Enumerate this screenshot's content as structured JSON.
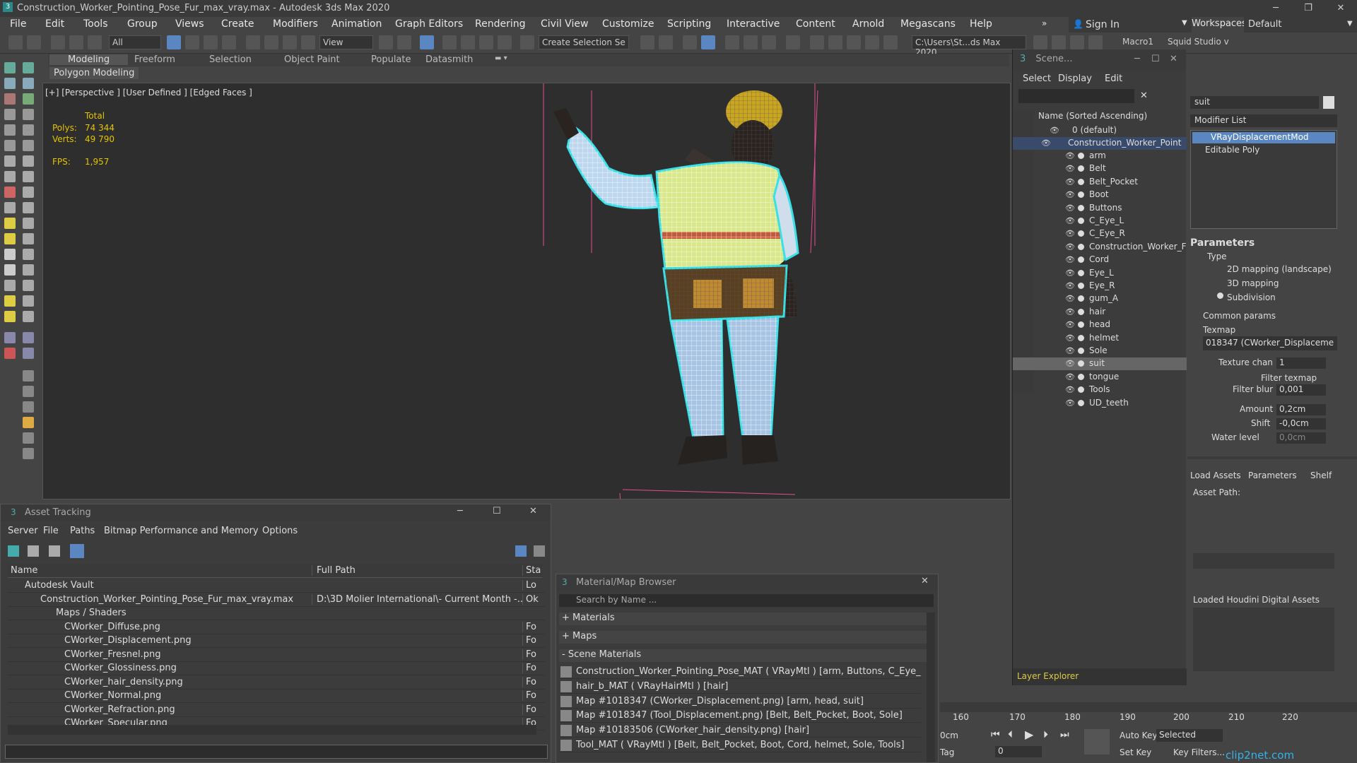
{
  "window": {
    "title": "Construction_Worker_Pointing_Pose_Fur_max_vray.max - Autodesk 3ds Max 2020",
    "minimize": "─",
    "maximize": "❐",
    "close": "✕"
  },
  "menu": [
    "File",
    "Edit",
    "Tools",
    "Group",
    "Views",
    "Create",
    "Modifiers",
    "Animation",
    "Graph Editors",
    "Rendering",
    "Civil View",
    "Customize",
    "Scripting",
    "Interactive",
    "Content",
    "Arnold",
    "Megascans",
    "Help"
  ],
  "signin": "Sign In",
  "workspaces_label": "Workspaces:",
  "workspaces_value": "Default",
  "toolbar": {
    "filter": "All",
    "view": "View",
    "selection_set": "Create Selection Se",
    "path": "C:\\Users\\St...ds Max 2020",
    "macro": "Macro1",
    "squid": "Squid Studio v"
  },
  "ribbon": {
    "tabs": [
      "Modeling",
      "Freeform",
      "Selection",
      "Object Paint",
      "Populate",
      "Datasmith"
    ],
    "subtab": "Polygon Modeling"
  },
  "viewport": {
    "label": "[+] [Perspective ] [User Defined ] [Edged Faces ]",
    "total": "Total",
    "polys_label": "Polys:",
    "polys": "74 344",
    "verts_label": "Verts:",
    "verts": "49 790",
    "fps_label": "FPS:",
    "fps": "1,957"
  },
  "scene": {
    "title": "Scene...",
    "menu": [
      "Select",
      "Display",
      "Edit"
    ],
    "col": "Name (Sorted Ascending)",
    "layer0": "0 (default)",
    "root": "Construction_Worker_Point",
    "items": [
      "arm",
      "Belt",
      "Belt_Pocket",
      "Boot",
      "Buttons",
      "C_Eye_L",
      "C_Eye_R",
      "Construction_Worker_F",
      "Cord",
      "Eye_L",
      "Eye_R",
      "gum_A",
      "hair",
      "head",
      "helmet",
      "Sole",
      "suit",
      "tongue",
      "Tools",
      "UD_teeth"
    ],
    "layer_explorer": "Layer Explorer"
  },
  "cmd": {
    "search": "suit",
    "modlist": "Modifier List",
    "mods": [
      "VRayDisplacementMod",
      "Editable Poly"
    ],
    "params_title": "Parameters",
    "type_label": "Type",
    "types": [
      "2D mapping (landscape)",
      "3D mapping",
      "Subdivision"
    ],
    "common": "Common params",
    "texmap_label": "Texmap",
    "texmap": "018347 (CWorker_Displaceme",
    "texchan_label": "Texture chan",
    "texchan": "1",
    "filter_texmap": "Filter texmap",
    "filter_blur_label": "Filter blur",
    "filter_blur": "0,001",
    "amount_label": "Amount",
    "amount": "0,2cm",
    "shift_label": "Shift",
    "shift": "-0,0cm",
    "water_label": "Water level",
    "water": "0,0cm",
    "tabs": [
      "Load Assets",
      "Parameters",
      "Shelf"
    ],
    "asset_path": "Asset Path:",
    "loaded": "Loaded Houdini Digital Assets"
  },
  "assets": {
    "title": "Asset Tracking",
    "menu": [
      "Server",
      "File",
      "Paths",
      "Bitmap Performance and Memory",
      "Options"
    ],
    "cols": [
      "Name",
      "Full Path",
      "Sta"
    ],
    "rows": [
      {
        "name": "Autodesk Vault",
        "path": "",
        "status": "Lo"
      },
      {
        "name": "Construction_Worker_Pointing_Pose_Fur_max_vray.max",
        "path": "D:\\3D Molier International\\- Current Month -...",
        "status": "Ok"
      },
      {
        "name": "Maps / Shaders",
        "path": "",
        "status": ""
      },
      {
        "name": "CWorker_Diffuse.png",
        "path": "",
        "status": "Fo"
      },
      {
        "name": "CWorker_Displacement.png",
        "path": "",
        "status": "Fo"
      },
      {
        "name": "CWorker_Fresnel.png",
        "path": "",
        "status": "Fo"
      },
      {
        "name": "CWorker_Glossiness.png",
        "path": "",
        "status": "Fo"
      },
      {
        "name": "CWorker_hair_density.png",
        "path": "",
        "status": "Fo"
      },
      {
        "name": "CWorker_Normal.png",
        "path": "",
        "status": "Fo"
      },
      {
        "name": "CWorker_Refraction.png",
        "path": "",
        "status": "Fo"
      },
      {
        "name": "CWorker_Specular.png",
        "path": "",
        "status": "Fo"
      }
    ]
  },
  "matbrowser": {
    "title": "Material/Map Browser",
    "search": "Search by Name ...",
    "materials": "+ Materials",
    "maps": "+ Maps",
    "scene_mats": "- Scene Materials",
    "rows": [
      "Construction_Worker_Pointing_Pose_MAT ( VRayMtl ) [arm, Buttons, C_Eye_L,...",
      "hair_b_MAT ( VRayHairMtl ) [hair]",
      "Map #1018347 (CWorker_Displacement.png) [arm, head, suit]",
      "Map #1018347 (Tool_Displacement.png) [Belt, Belt_Pocket, Boot, Sole]",
      "Map #10183506 (CWorker_hair_density.png) [hair]",
      "Tool_MAT ( VRayMtl ) [Belt, Belt_Pocket, Boot, Cord, helmet, Sole, Tools]"
    ]
  },
  "timeline": {
    "ticks": [
      "160",
      "170",
      "180",
      "190",
      "200",
      "210",
      "220"
    ],
    "cm": "0cm",
    "tag": "Tag",
    "frame": "0",
    "autokey": "Auto Key",
    "setkey": "Set Key",
    "selected": "Selected",
    "keyfilters": "Key Filters...",
    "watermark": "clip2net.com"
  }
}
